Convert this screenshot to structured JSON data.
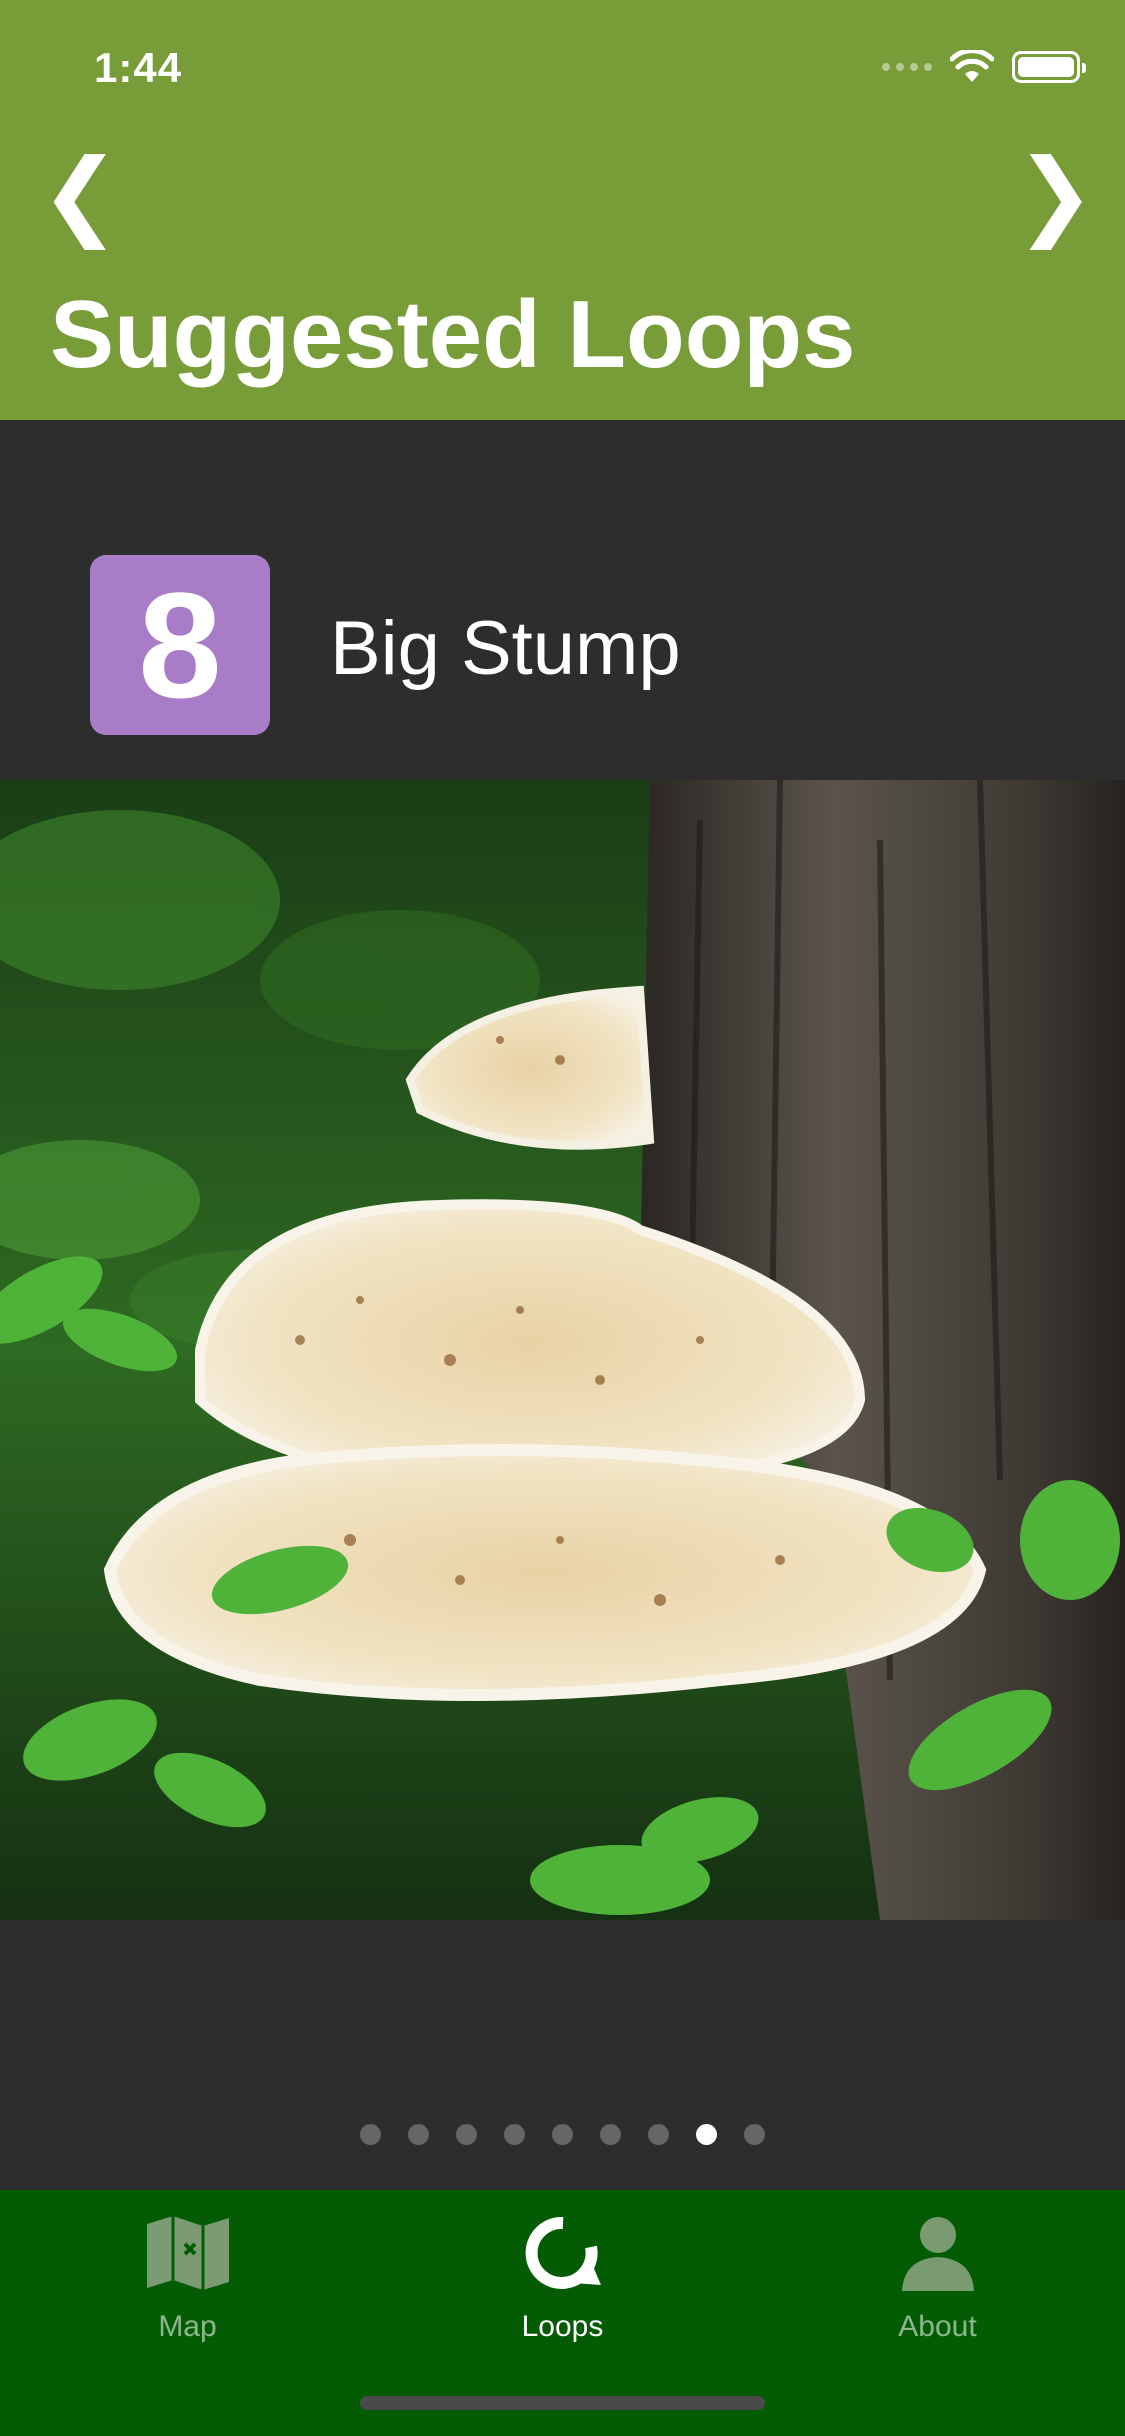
{
  "status_bar": {
    "time": "1:44"
  },
  "header": {
    "title": "Suggested Loops",
    "prev_glyph": "❮",
    "next_glyph": "❯"
  },
  "loop": {
    "number": "8",
    "name": "Big Stump",
    "badge_color": "#a97cc8"
  },
  "pager": {
    "count": 9,
    "active_index": 7
  },
  "tabs": [
    {
      "label": "Map",
      "icon": "map-icon",
      "active": false
    },
    {
      "label": "Loops",
      "icon": "loop-icon",
      "active": true
    },
    {
      "label": "About",
      "icon": "person-icon",
      "active": false
    }
  ],
  "colors": {
    "header": "#779c38",
    "tabbar": "#035b03",
    "background": "#2d2d2d"
  }
}
